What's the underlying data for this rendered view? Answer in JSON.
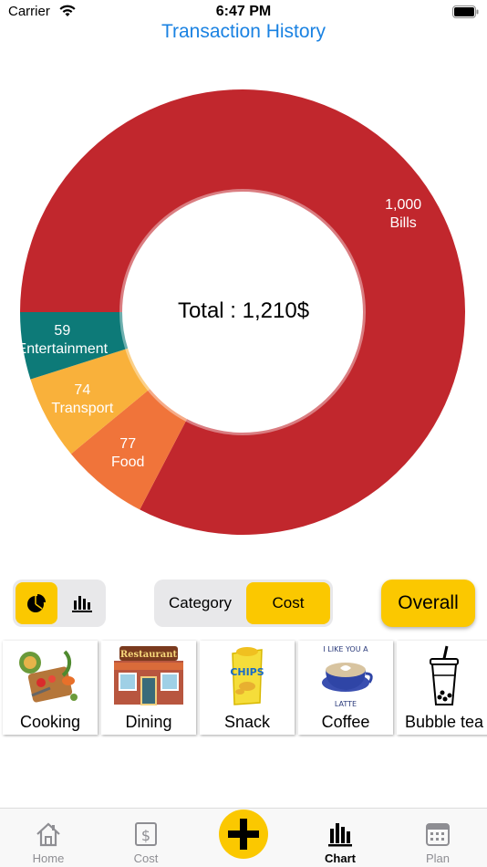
{
  "status_bar": {
    "carrier": "Carrier",
    "time": "6:47 PM"
  },
  "header": {
    "title": "Transaction History"
  },
  "chart_data": {
    "type": "pie",
    "variant": "donut",
    "center_label": "Total : 1,210$",
    "slices": [
      {
        "label": "Bills",
        "value": 1000,
        "value_label": "1,000",
        "color": "#c1272d"
      },
      {
        "label": "Food",
        "value": 77,
        "value_label": "77",
        "color": "#f0743a"
      },
      {
        "label": "Transport",
        "value": 74,
        "value_label": "74",
        "color": "#f9b13b"
      },
      {
        "label": "Entertainment",
        "value": 59,
        "value_label": "59",
        "color": "#0d7a78"
      }
    ]
  },
  "controls": {
    "chart_types": [
      {
        "name": "pie",
        "icon": "pie-chart-icon",
        "active": true
      },
      {
        "name": "bar",
        "icon": "bar-chart-icon",
        "active": false
      }
    ],
    "mode": {
      "options": [
        "Category",
        "Cost"
      ],
      "selected": "Cost"
    },
    "overall_label": "Overall"
  },
  "categories": [
    {
      "label": "Cooking",
      "icon": "cooking-icon"
    },
    {
      "label": "Dining",
      "icon": "restaurant-icon"
    },
    {
      "label": "Snack",
      "icon": "chips-icon"
    },
    {
      "label": "Coffee",
      "icon": "coffee-icon"
    },
    {
      "label": "Bubble tea",
      "icon": "bubble-tea-icon"
    }
  ],
  "coffee_art_text": {
    "top": "I LIKE YOU A",
    "bottom": "LATTE"
  },
  "restaurant_sign": "Restaurant",
  "chips_text": "CHIPS",
  "tab_bar": {
    "items": [
      {
        "label": "Home",
        "icon": "home-icon"
      },
      {
        "label": "Cost",
        "icon": "dollar-icon"
      },
      {
        "label": "Chart",
        "icon": "bar-chart-icon",
        "active": true
      },
      {
        "label": "Plan",
        "icon": "calendar-icon"
      }
    ],
    "add_icon": "plus-icon"
  },
  "colors": {
    "accent": "#fbc800",
    "title": "#1a82e2"
  }
}
